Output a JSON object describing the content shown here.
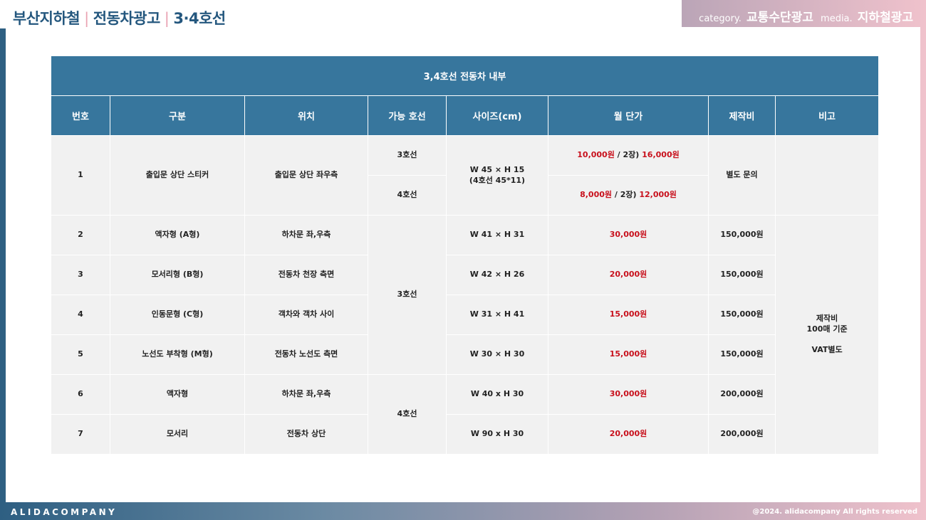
{
  "header": {
    "title_parts": [
      "부산지하철",
      "전동차광고",
      "3·4호선"
    ],
    "separator": "|",
    "category_label": "category.",
    "category_value": "교통수단광고",
    "media_label": "media.",
    "media_value": "지하철광고"
  },
  "footer": {
    "brand": "ALIDACOMPANY",
    "copyright": "@2024. alidacompany All rights reserved"
  },
  "table": {
    "caption": "3,4호선 전동차 내부",
    "columns": [
      "번호",
      "구분",
      "위치",
      "가능 호선",
      "사이즈(cm)",
      "월 단가",
      "제작비",
      "비고"
    ],
    "row1": {
      "no": "1",
      "type": "출입문 상단 스티커",
      "position": "출입문 상단 좌우측",
      "line_a": "3호선",
      "line_b": "4호선",
      "size_line1": "W 45 × H 15",
      "size_line2": "(4호선 45*11)",
      "price_a_1": "10,000원",
      "price_a_mid": " / 2장) ",
      "price_a_2": "16,000원",
      "price_b_1": "8,000원",
      "price_b_mid": " / 2장) ",
      "price_b_2": "12,000원",
      "production": "별도 문의"
    },
    "rows": [
      {
        "no": "2",
        "type": "액자형 (A형)",
        "position": "하차문 좌,우측",
        "size": "W 41 × H 31",
        "price": "30,000원",
        "production": "150,000원"
      },
      {
        "no": "3",
        "type": "모서리형 (B형)",
        "position": "전동차 천장 측면",
        "size": "W 42 × H 26",
        "price": "20,000원",
        "production": "150,000원"
      },
      {
        "no": "4",
        "type": "인동문형 (C형)",
        "position": "객차와 객차 사이",
        "size": "W 31 × H 41",
        "price": "15,000원",
        "production": "150,000원"
      },
      {
        "no": "5",
        "type": "노선도 부착형 (M형)",
        "position": "전동차 노선도 측면",
        "size": "W 30 × H 30",
        "price": "15,000원",
        "production": "150,000원"
      },
      {
        "no": "6",
        "type": "액자형",
        "position": "하차문 좌,우측",
        "size": "W 40 x H 30",
        "price": "30,000원",
        "production": "200,000원"
      },
      {
        "no": "7",
        "type": "모서리",
        "position": "전동차 상단",
        "size": "W 90 x H 30",
        "price": "20,000원",
        "production": "200,000원"
      }
    ],
    "line_group_1": "3호선",
    "line_group_2": "4호선",
    "note_line1": "제작비",
    "note_line2": "100매 기준",
    "note_line3": "VAT별도"
  }
}
